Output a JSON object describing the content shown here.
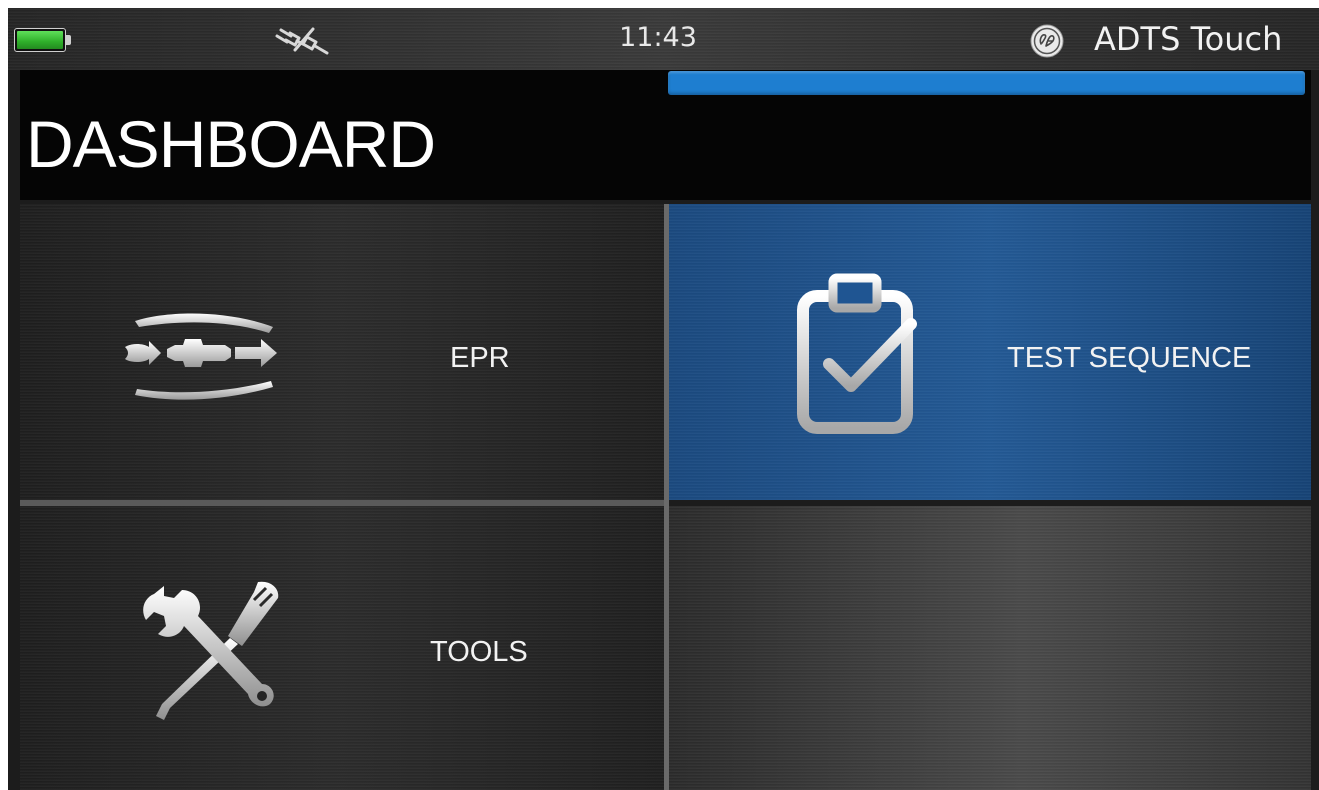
{
  "status_bar": {
    "clock": "11:43",
    "battery_icon": "battery-full-icon",
    "battery_color": "#2fb02a",
    "connection_icon": "disconnected-plug-icon",
    "brand_logo": "ge-logo",
    "app_name": "ADTS Touch"
  },
  "header": {
    "title": "DASHBOARD",
    "progress_color": "#1e7ed0"
  },
  "tiles": [
    {
      "label": "EPR",
      "icon": "engine-pressure-ratio-icon",
      "selected": false
    },
    {
      "label": "TEST SEQUENCE",
      "icon": "clipboard-check-icon",
      "selected": true
    },
    {
      "label": "TOOLS",
      "icon": "wrench-screwdriver-icon",
      "selected": false
    }
  ],
  "colors": {
    "selected_tile": "#1c4f86",
    "tile": "#222222"
  }
}
